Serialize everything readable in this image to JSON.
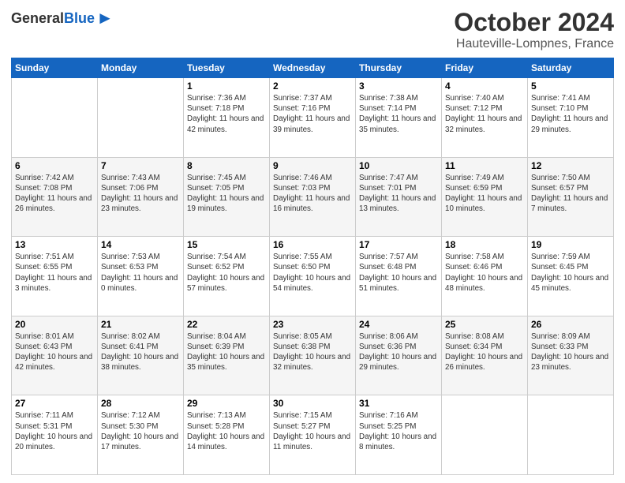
{
  "header": {
    "logo_general": "General",
    "logo_blue": "Blue",
    "month": "October 2024",
    "location": "Hauteville-Lompnes, France"
  },
  "days_of_week": [
    "Sunday",
    "Monday",
    "Tuesday",
    "Wednesday",
    "Thursday",
    "Friday",
    "Saturday"
  ],
  "weeks": [
    [
      {
        "day": "",
        "sunrise": "",
        "sunset": "",
        "daylight": ""
      },
      {
        "day": "",
        "sunrise": "",
        "sunset": "",
        "daylight": ""
      },
      {
        "day": "1",
        "sunrise": "Sunrise: 7:36 AM",
        "sunset": "Sunset: 7:18 PM",
        "daylight": "Daylight: 11 hours and 42 minutes."
      },
      {
        "day": "2",
        "sunrise": "Sunrise: 7:37 AM",
        "sunset": "Sunset: 7:16 PM",
        "daylight": "Daylight: 11 hours and 39 minutes."
      },
      {
        "day": "3",
        "sunrise": "Sunrise: 7:38 AM",
        "sunset": "Sunset: 7:14 PM",
        "daylight": "Daylight: 11 hours and 35 minutes."
      },
      {
        "day": "4",
        "sunrise": "Sunrise: 7:40 AM",
        "sunset": "Sunset: 7:12 PM",
        "daylight": "Daylight: 11 hours and 32 minutes."
      },
      {
        "day": "5",
        "sunrise": "Sunrise: 7:41 AM",
        "sunset": "Sunset: 7:10 PM",
        "daylight": "Daylight: 11 hours and 29 minutes."
      }
    ],
    [
      {
        "day": "6",
        "sunrise": "Sunrise: 7:42 AM",
        "sunset": "Sunset: 7:08 PM",
        "daylight": "Daylight: 11 hours and 26 minutes."
      },
      {
        "day": "7",
        "sunrise": "Sunrise: 7:43 AM",
        "sunset": "Sunset: 7:06 PM",
        "daylight": "Daylight: 11 hours and 23 minutes."
      },
      {
        "day": "8",
        "sunrise": "Sunrise: 7:45 AM",
        "sunset": "Sunset: 7:05 PM",
        "daylight": "Daylight: 11 hours and 19 minutes."
      },
      {
        "day": "9",
        "sunrise": "Sunrise: 7:46 AM",
        "sunset": "Sunset: 7:03 PM",
        "daylight": "Daylight: 11 hours and 16 minutes."
      },
      {
        "day": "10",
        "sunrise": "Sunrise: 7:47 AM",
        "sunset": "Sunset: 7:01 PM",
        "daylight": "Daylight: 11 hours and 13 minutes."
      },
      {
        "day": "11",
        "sunrise": "Sunrise: 7:49 AM",
        "sunset": "Sunset: 6:59 PM",
        "daylight": "Daylight: 11 hours and 10 minutes."
      },
      {
        "day": "12",
        "sunrise": "Sunrise: 7:50 AM",
        "sunset": "Sunset: 6:57 PM",
        "daylight": "Daylight: 11 hours and 7 minutes."
      }
    ],
    [
      {
        "day": "13",
        "sunrise": "Sunrise: 7:51 AM",
        "sunset": "Sunset: 6:55 PM",
        "daylight": "Daylight: 11 hours and 3 minutes."
      },
      {
        "day": "14",
        "sunrise": "Sunrise: 7:53 AM",
        "sunset": "Sunset: 6:53 PM",
        "daylight": "Daylight: 11 hours and 0 minutes."
      },
      {
        "day": "15",
        "sunrise": "Sunrise: 7:54 AM",
        "sunset": "Sunset: 6:52 PM",
        "daylight": "Daylight: 10 hours and 57 minutes."
      },
      {
        "day": "16",
        "sunrise": "Sunrise: 7:55 AM",
        "sunset": "Sunset: 6:50 PM",
        "daylight": "Daylight: 10 hours and 54 minutes."
      },
      {
        "day": "17",
        "sunrise": "Sunrise: 7:57 AM",
        "sunset": "Sunset: 6:48 PM",
        "daylight": "Daylight: 10 hours and 51 minutes."
      },
      {
        "day": "18",
        "sunrise": "Sunrise: 7:58 AM",
        "sunset": "Sunset: 6:46 PM",
        "daylight": "Daylight: 10 hours and 48 minutes."
      },
      {
        "day": "19",
        "sunrise": "Sunrise: 7:59 AM",
        "sunset": "Sunset: 6:45 PM",
        "daylight": "Daylight: 10 hours and 45 minutes."
      }
    ],
    [
      {
        "day": "20",
        "sunrise": "Sunrise: 8:01 AM",
        "sunset": "Sunset: 6:43 PM",
        "daylight": "Daylight: 10 hours and 42 minutes."
      },
      {
        "day": "21",
        "sunrise": "Sunrise: 8:02 AM",
        "sunset": "Sunset: 6:41 PM",
        "daylight": "Daylight: 10 hours and 38 minutes."
      },
      {
        "day": "22",
        "sunrise": "Sunrise: 8:04 AM",
        "sunset": "Sunset: 6:39 PM",
        "daylight": "Daylight: 10 hours and 35 minutes."
      },
      {
        "day": "23",
        "sunrise": "Sunrise: 8:05 AM",
        "sunset": "Sunset: 6:38 PM",
        "daylight": "Daylight: 10 hours and 32 minutes."
      },
      {
        "day": "24",
        "sunrise": "Sunrise: 8:06 AM",
        "sunset": "Sunset: 6:36 PM",
        "daylight": "Daylight: 10 hours and 29 minutes."
      },
      {
        "day": "25",
        "sunrise": "Sunrise: 8:08 AM",
        "sunset": "Sunset: 6:34 PM",
        "daylight": "Daylight: 10 hours and 26 minutes."
      },
      {
        "day": "26",
        "sunrise": "Sunrise: 8:09 AM",
        "sunset": "Sunset: 6:33 PM",
        "daylight": "Daylight: 10 hours and 23 minutes."
      }
    ],
    [
      {
        "day": "27",
        "sunrise": "Sunrise: 7:11 AM",
        "sunset": "Sunset: 5:31 PM",
        "daylight": "Daylight: 10 hours and 20 minutes."
      },
      {
        "day": "28",
        "sunrise": "Sunrise: 7:12 AM",
        "sunset": "Sunset: 5:30 PM",
        "daylight": "Daylight: 10 hours and 17 minutes."
      },
      {
        "day": "29",
        "sunrise": "Sunrise: 7:13 AM",
        "sunset": "Sunset: 5:28 PM",
        "daylight": "Daylight: 10 hours and 14 minutes."
      },
      {
        "day": "30",
        "sunrise": "Sunrise: 7:15 AM",
        "sunset": "Sunset: 5:27 PM",
        "daylight": "Daylight: 10 hours and 11 minutes."
      },
      {
        "day": "31",
        "sunrise": "Sunrise: 7:16 AM",
        "sunset": "Sunset: 5:25 PM",
        "daylight": "Daylight: 10 hours and 8 minutes."
      },
      {
        "day": "",
        "sunrise": "",
        "sunset": "",
        "daylight": ""
      },
      {
        "day": "",
        "sunrise": "",
        "sunset": "",
        "daylight": ""
      }
    ]
  ]
}
